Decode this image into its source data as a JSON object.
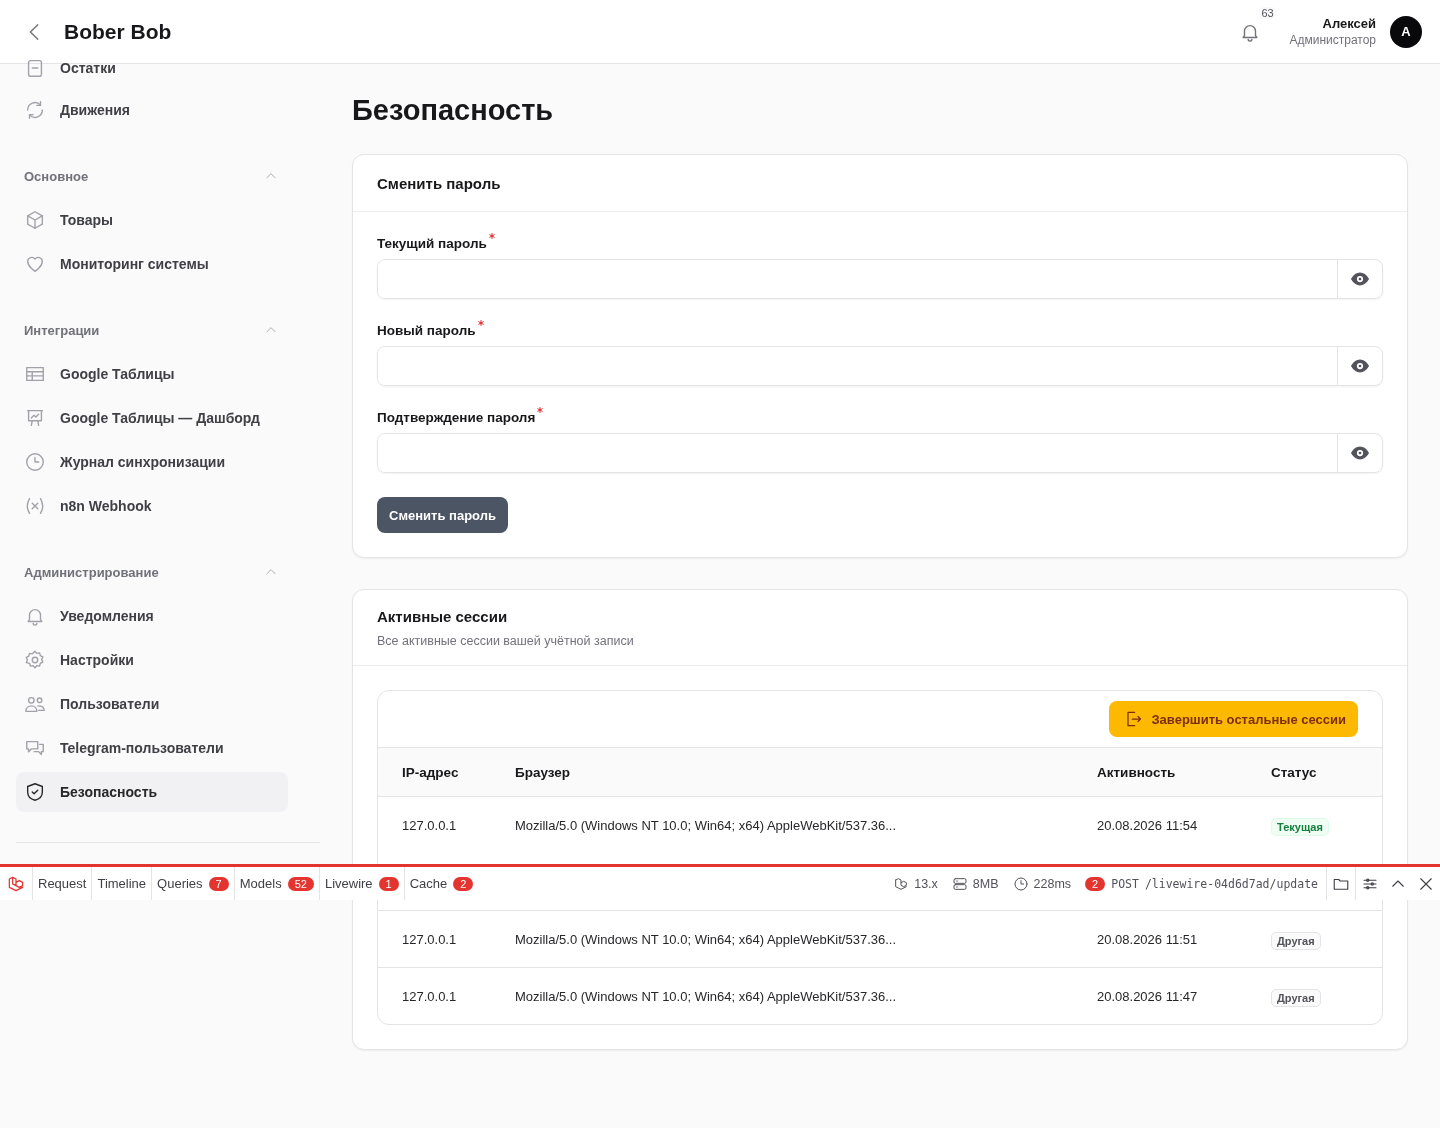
{
  "header": {
    "title": "Bober Bob",
    "notifications": {
      "count": "63"
    },
    "user": {
      "name": "Алексей",
      "role": "Администратор",
      "initial": "A"
    }
  },
  "sidebar": {
    "items": [
      {
        "label": "Остатки",
        "selected": false
      },
      {
        "label": "Движения",
        "selected": false
      }
    ],
    "groups": [
      {
        "label": "Основное",
        "expanded": true,
        "items": [
          {
            "label": "Товары",
            "selected": false
          },
          {
            "label": "Мониторинг системы",
            "selected": false
          }
        ]
      },
      {
        "label": "Интеграции",
        "expanded": true,
        "items": [
          {
            "label": "Google Таблицы",
            "selected": false
          },
          {
            "label": "Google Таблицы — Дашборд",
            "selected": false
          },
          {
            "label": "Журнал синхронизации",
            "selected": false
          },
          {
            "label": "n8n Webhook",
            "selected": false
          }
        ]
      },
      {
        "label": "Администрирование",
        "expanded": true,
        "items": [
          {
            "label": "Уведомления",
            "selected": false
          },
          {
            "label": "Настройки",
            "selected": false
          },
          {
            "label": "Пользователи",
            "selected": false
          },
          {
            "label": "Telegram-пользователи",
            "selected": false
          },
          {
            "label": "Безопасность",
            "selected": true
          }
        ]
      }
    ]
  },
  "page_title": "Безопасность",
  "password_form": {
    "title": "Сменить пароль",
    "fields": [
      {
        "label": "Текущий пароль",
        "required": true
      },
      {
        "label": "Новый пароль",
        "required": true
      },
      {
        "label": "Подтверждение пароля",
        "required": true
      }
    ],
    "submit": "Сменить пароль"
  },
  "sessions": {
    "title": "Активные сессии",
    "subtitle": "Все активные сессии вашей учётной записи",
    "action": "Завершить остальные сессии",
    "columns": [
      "IP-адрес",
      "Браузер",
      "Активность",
      "Статус"
    ],
    "rows": [
      {
        "ip": "127.0.0.1",
        "browser": "Mozilla/5.0 (Windows NT 10.0; Win64; x64) AppleWebKit/537.36...",
        "activity": "20.08.2026 11:54",
        "status": "Текущая",
        "current": true
      },
      {
        "ip": "127.0.0.1",
        "browser": "Mozilla/5.0 (Windows NT 10.0; Win64; x64) AppleWebKit/537.36...",
        "activity": "20.08.2026 11:51",
        "status": "Другая",
        "current": false
      },
      {
        "ip": "127.0.0.1",
        "browser": "Mozilla/5.0 (Windows NT 10.0; Win64; x64) AppleWebKit/537.36...",
        "activity": "20.08.2026 11:47",
        "status": "Другая",
        "current": false
      }
    ]
  },
  "debug_bar": {
    "tabs": [
      {
        "label": "Request"
      },
      {
        "label": "Timeline"
      },
      {
        "label": "Queries",
        "count": "7"
      },
      {
        "label": "Models",
        "count": "52"
      },
      {
        "label": "Livewire",
        "count": "1"
      },
      {
        "label": "Cache",
        "count": "2"
      }
    ],
    "version": "13.x",
    "memory": "8MB",
    "duration": "228ms",
    "request": {
      "count": "2",
      "method": "POST",
      "path": "/livewire-04d6d7ad/update"
    }
  }
}
